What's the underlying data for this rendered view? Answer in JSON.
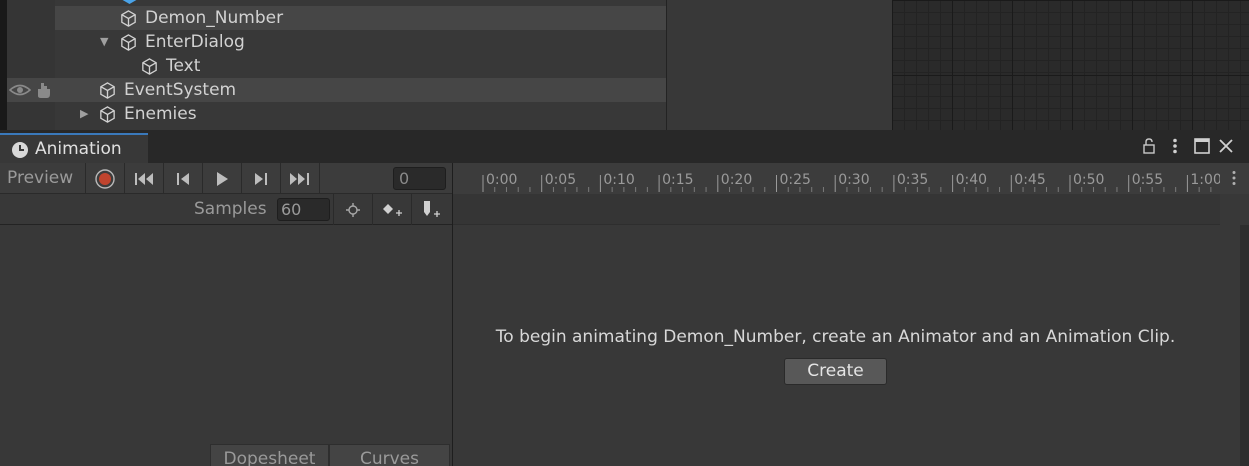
{
  "hierarchy": {
    "items": [
      {
        "label": "Demon_Number",
        "selected": true
      },
      {
        "label": "EnterDialog",
        "expanded": true
      },
      {
        "label": "Text"
      },
      {
        "label": "EventSystem",
        "highlighted": true
      },
      {
        "label": "Enemies",
        "expanded": false
      }
    ],
    "gutter_icons": [
      "eye-icon",
      "hand-pick-icon"
    ]
  },
  "animation_window": {
    "tab_title": "Animation",
    "window_controls": [
      "lock-icon",
      "kebab-menu-icon",
      "maximize-icon",
      "close-icon"
    ],
    "toolbar": {
      "preview_label": "Preview",
      "frame_value": "0",
      "buttons": [
        "record-icon",
        "first-key-icon",
        "prev-key-icon",
        "play-icon",
        "next-key-icon",
        "last-key-icon"
      ]
    },
    "samples": {
      "label": "Samples",
      "value": "60",
      "buttons": [
        "filter-icon",
        "add-keyframe-icon",
        "add-event-icon"
      ]
    },
    "timeline": {
      "ticks": [
        "0:00",
        "0:05",
        "0:10",
        "0:15",
        "0:20",
        "0:25",
        "0:30",
        "0:35",
        "0:40",
        "0:45",
        "0:50",
        "0:55",
        "1:00"
      ]
    },
    "empty_message": "To begin animating Demon_Number, create an Animator and an Animation Clip.",
    "create_label": "Create",
    "bottom_tabs": [
      "Dopesheet",
      "Curves"
    ]
  },
  "colors": {
    "accent": "#3a79bb",
    "record": "#c0442e",
    "panel": "#383838",
    "text": "#d2d2d2"
  }
}
